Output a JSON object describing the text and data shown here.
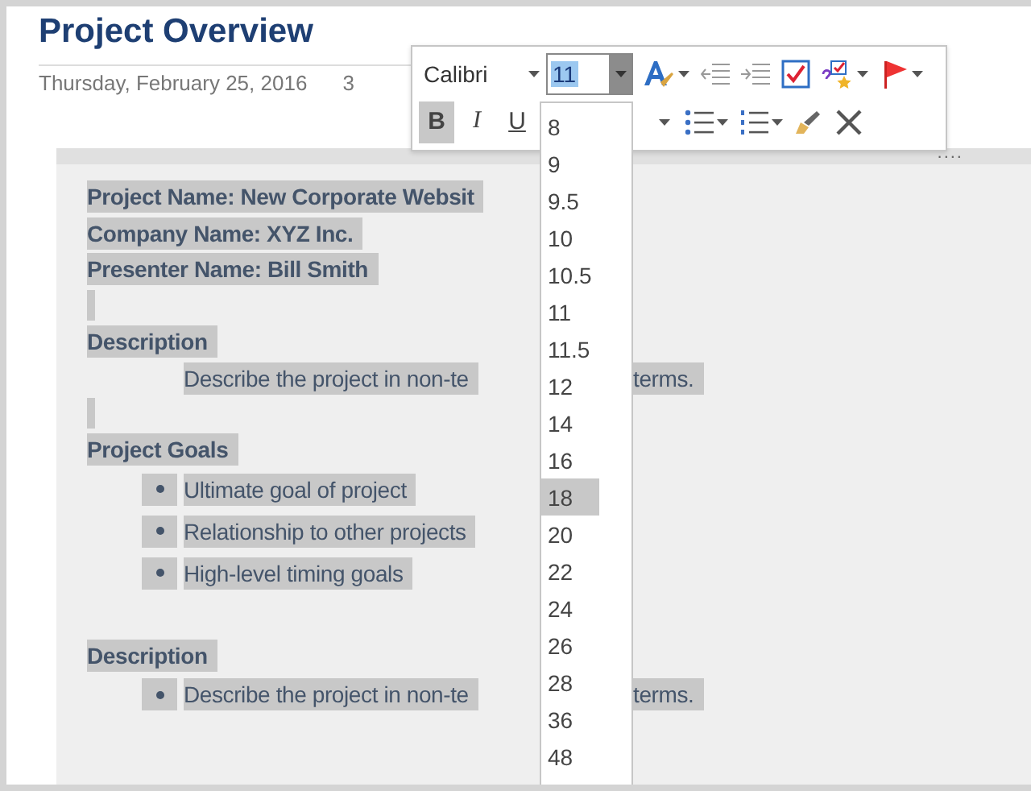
{
  "page": {
    "title": "Project Overview",
    "date": "Thursday, February 25, 2016",
    "time": "3"
  },
  "toolbar": {
    "font": "Calibri",
    "size": "11",
    "bold": true,
    "italic": false,
    "underline": false,
    "bold_label": "B",
    "italic_label": "I",
    "underline_label": "U"
  },
  "size_menu": [
    {
      "label": "8",
      "highlighted": false
    },
    {
      "label": "9",
      "highlighted": false
    },
    {
      "label": "9.5",
      "highlighted": false
    },
    {
      "label": "10",
      "highlighted": false
    },
    {
      "label": "10.5",
      "highlighted": false
    },
    {
      "label": "11",
      "highlighted": false
    },
    {
      "label": "11.5",
      "highlighted": false
    },
    {
      "label": "12",
      "highlighted": false
    },
    {
      "label": "14",
      "highlighted": false
    },
    {
      "label": "16",
      "highlighted": false
    },
    {
      "label": "18",
      "highlighted": true
    },
    {
      "label": "20",
      "highlighted": false
    },
    {
      "label": "22",
      "highlighted": false
    },
    {
      "label": "24",
      "highlighted": false
    },
    {
      "label": "26",
      "highlighted": false
    },
    {
      "label": "28",
      "highlighted": false
    },
    {
      "label": "36",
      "highlighted": false
    },
    {
      "label": "48",
      "highlighted": false
    }
  ],
  "note": {
    "handle": "....",
    "lines": [
      {
        "kind": "heading",
        "text": "Project Name: New Corporate Websit"
      },
      {
        "kind": "heading",
        "text": "Company Name: XYZ Inc."
      },
      {
        "kind": "heading",
        "text": "Presenter Name: Bill Smith"
      },
      {
        "kind": "empty"
      },
      {
        "kind": "heading",
        "text": "Description"
      },
      {
        "kind": "indent",
        "text": "Describe the project in non-te",
        "text_after": "terms."
      },
      {
        "kind": "empty"
      },
      {
        "kind": "heading",
        "text": "Project Goals"
      },
      {
        "kind": "bullet",
        "text": "Ultimate goal of project"
      },
      {
        "kind": "bullet",
        "text": "Relationship to other projects"
      },
      {
        "kind": "bullet",
        "text": "High-level timing goals"
      },
      {
        "kind": "gap"
      },
      {
        "kind": "heading",
        "text": "Description"
      },
      {
        "kind": "bullet",
        "text": "Describe the project in non-te",
        "text_after": "terms."
      }
    ]
  }
}
